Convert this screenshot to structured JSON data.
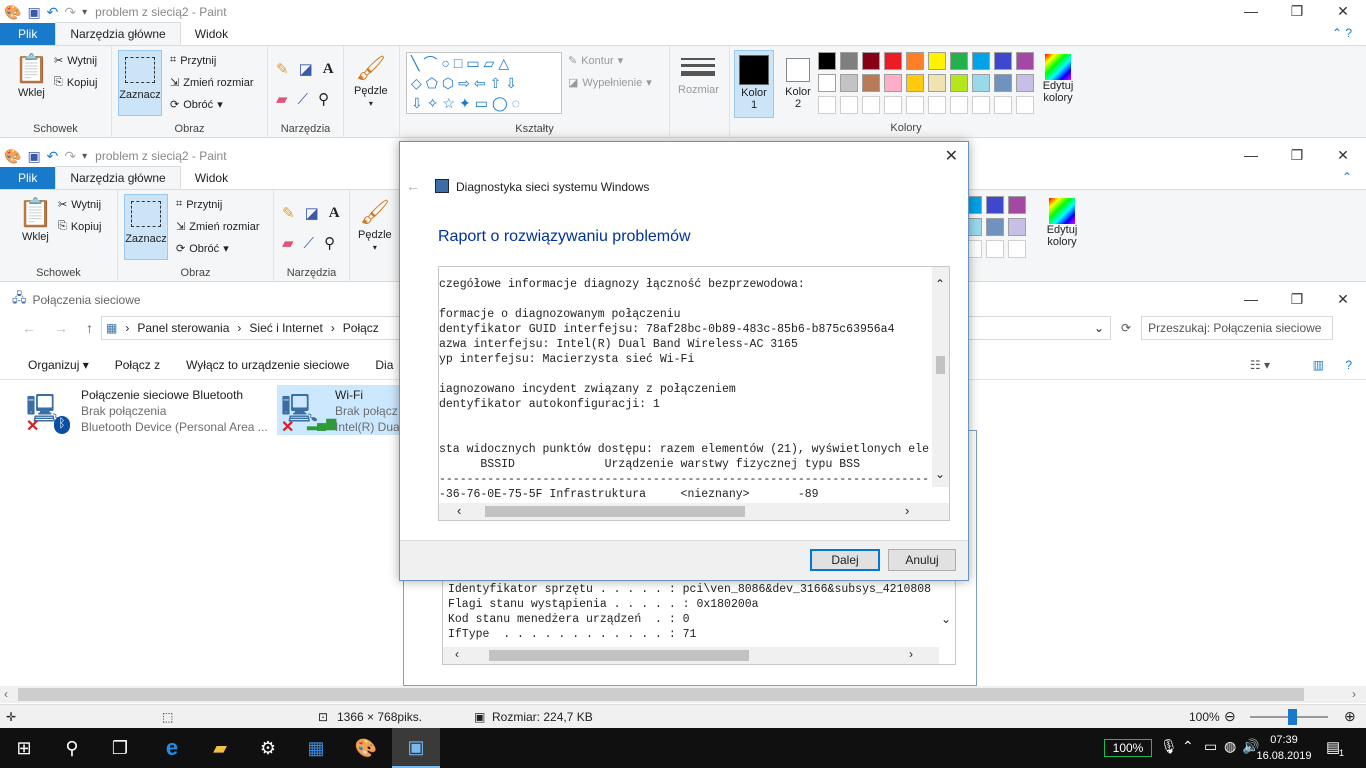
{
  "paint_back": {
    "title": "problem z siecią2 - Paint",
    "tab_file": "Plik",
    "tab_home": "Narzędzia główne",
    "tab_view": "Widok",
    "paste": "Wklej",
    "cut": "Wytnij",
    "copy": "Kopiuj",
    "clipboard": "Schowek",
    "select": "Zaznacz",
    "crop": "Przytnij",
    "resize": "Zmień rozmiar",
    "rotate": "Obróć",
    "image": "Obraz",
    "tools": "Narzędzia",
    "brushes": "Pędzle",
    "outline": "Kontur",
    "fill": "Wypełnienie",
    "shapes": "Kształty",
    "size": "Rozmiar",
    "color1": "Kolor",
    "color1_num": "1",
    "color2": "Kolor",
    "color2_num": "2",
    "edit_colors": "Edytuj",
    "edit_colors2": "kolory",
    "colors": "Kolory"
  },
  "paint_front": {
    "title": "problem z siecią2 - Paint",
    "tab_file": "Plik",
    "tab_home": "Narzędzia główne",
    "tab_view": "Widok",
    "paste": "Wklej",
    "cut": "Wytnij",
    "copy": "Kopiuj",
    "clipboard": "Schowek",
    "select": "Zaznacz",
    "crop": "Przytnij",
    "resize": "Zmień rozmiar",
    "rotate": "Obróć",
    "image": "Obraz",
    "tools": "Narzędzia",
    "brushes": "Pędzle",
    "edit_colors": "Edytuj",
    "edit_colors2": "kolory"
  },
  "explorer": {
    "title": "Połączenia sieciowe",
    "breadcrumb_1": "Panel sterowania",
    "breadcrumb_2": "Sieć i Internet",
    "breadcrumb_3": "Połącz",
    "search_placeholder": "Przeszukaj: Połączenia sieciowe",
    "cmd_organize": "Organizuj",
    "cmd_connect": "Połącz z",
    "cmd_disable": "Wyłącz to urządzenie sieciowe",
    "cmd_diag": "Dia",
    "bt_name": "Połączenie sieciowe Bluetooth",
    "bt_status": "Brak połączenia",
    "bt_device": "Bluetooth Device (Personal Area ...",
    "wifi_name": "Wi-Fi",
    "wifi_status": "Brak połącz",
    "wifi_device": "Intel(R) Dual"
  },
  "behind_text": [
    "Identyfikator sprzętu . . . . . : pci\\ven_8086&dev_3166&subsys_4210808",
    "Flagi stanu wystąpienia . . . . . : 0x180200a",
    "Kod stanu menedżera urządzeń  . : 0",
    "IfType  . . . . . . . . . . . . : 71"
  ],
  "dialog": {
    "app_title": "Diagnostyka sieci systemu Windows",
    "heading": "Raport o rozwiązywaniu problemów",
    "lines": [
      "czegółowe informacje diagnozy łączność bezprzewodowa:",
      "",
      "formacje o diagnozowanym połączeniu",
      "dentyfikator GUID interfejsu: 78af28bc-0b89-483c-85b6-b875c63956a4",
      "azwa interfejsu: Intel(R) Dual Band Wireless-AC 3165",
      "yp interfejsu: Macierzysta sieć Wi-Fi",
      "",
      "iagnozowano incydent związany z połączeniem",
      "dentyfikator autokonfiguracji: 1",
      "",
      "",
      "sta widocznych punktów dostępu: razem elementów (21), wyświetlonych ele",
      "      BSSID             Urządzenie warstwy fizycznej typu BSS",
      "-----------------------------------------------------------------------",
      "-36-76-0E-75-5F Infrastruktura     <nieznany>       -89"
    ],
    "next": "Dalej",
    "cancel": "Anuluj"
  },
  "statusbar": {
    "dims": "1366 × 768piks.",
    "size": "Rozmiar: 224,7 KB",
    "zoom": "100%"
  },
  "taskbar": {
    "battery": "100%",
    "time": "07:39",
    "date": "16.08.2019",
    "notif": "1"
  },
  "colors": {
    "palette_row1": [
      "#000000",
      "#7f7f7f",
      "#880015",
      "#ed1c24",
      "#ff7f27",
      "#fff200",
      "#22b14c",
      "#00a2e8",
      "#3f48cc",
      "#a349a4"
    ],
    "palette_row2": [
      "#ffffff",
      "#c3c3c3",
      "#b97a57",
      "#ffaec9",
      "#ffc90e",
      "#efe4b0",
      "#b5e61d",
      "#99d9ea",
      "#7092be",
      "#c8bfe7"
    ]
  }
}
